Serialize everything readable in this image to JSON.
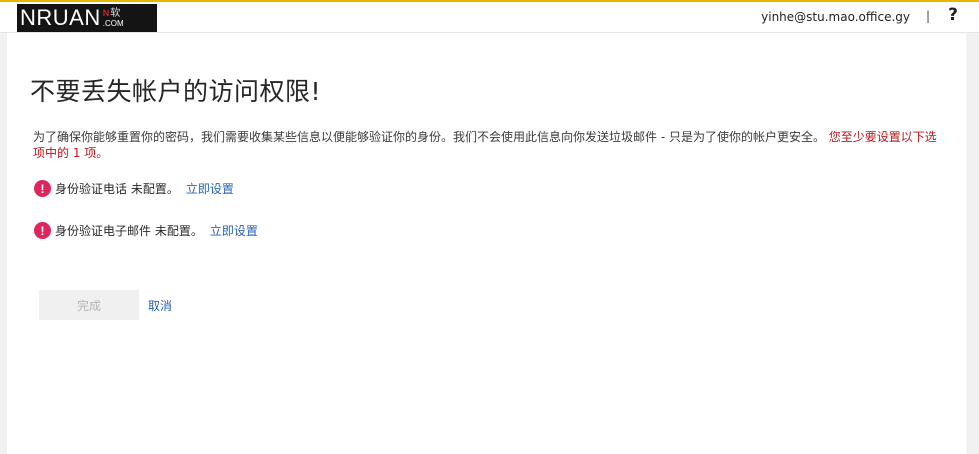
{
  "header": {
    "logo": {
      "main": "NRUAN",
      "cn_mark": "N",
      "cn": "软",
      "com": ".COM"
    },
    "user_email": "yinhe@stu.mao.office.gy",
    "divider": "|",
    "help": "?"
  },
  "main": {
    "title": "不要丢失帐户的访问权限!",
    "description": "为了确保你能够重置你的密码，我们需要收集某些信息以便能够验证你的身份。我们不会使用此信息向你发送垃圾邮件 - 只是为了使你的帐户更安全。",
    "requirement": "您至少要设置以下选项中的 1 项。",
    "items": [
      {
        "icon": "!",
        "label": "身份验证电话 未配置。",
        "action": "立即设置"
      },
      {
        "icon": "!",
        "label": "身份验证电子邮件 未配置。",
        "action": "立即设置"
      }
    ],
    "finish_label": "完成",
    "cancel_label": "取消"
  },
  "colors": {
    "accent_link": "#2a63b4",
    "alert": "#e0245e",
    "requirement_text": "#c0161c",
    "top_rule": "#e3b800"
  }
}
